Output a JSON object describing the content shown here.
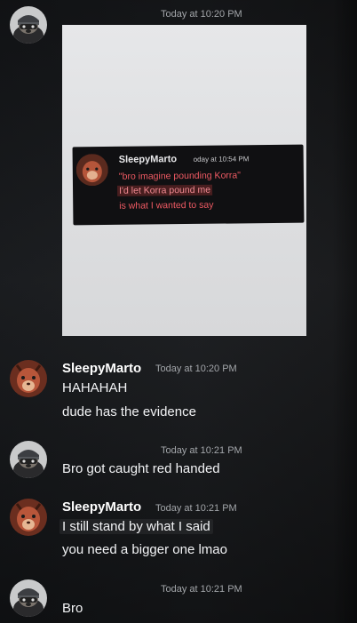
{
  "messages": [
    {
      "author": "",
      "timestamp": "Today at 10:20 PM",
      "avatar_icon": "raccoon-avatar-icon"
    },
    {
      "author": "SleepyMarto",
      "timestamp": "Today at 10:20 PM",
      "lines": [
        "HAHAHAH",
        "dude has the evidence"
      ],
      "avatar_icon": "deer-avatar-icon"
    },
    {
      "author": "",
      "timestamp": "Today at 10:21 PM",
      "lines": [
        "Bro got caught red handed"
      ],
      "avatar_icon": "raccoon-avatar-icon"
    },
    {
      "author": "SleepyMarto",
      "timestamp": "Today at 10:21 PM",
      "lines": [
        "I still stand by what I said",
        "you need a bigger one lmao"
      ],
      "avatar_icon": "deer-avatar-icon"
    },
    {
      "author": "",
      "timestamp": "Today at 10:21 PM",
      "lines": [
        "Bro"
      ],
      "avatar_icon": "raccoon-avatar-icon"
    }
  ],
  "attachment": {
    "author": "SleepyMarto",
    "timestamp": "oday at 10:54 PM",
    "quote": "\"bro imagine pounding Korra\"",
    "mention_line": "I'd let Korra pound me",
    "plain_line": "is what I wanted to say"
  },
  "colors": {
    "background": "#1b1d20",
    "username": "#ffffff",
    "timestamp": "#a3a6aa",
    "message_text": "#f2f3f5",
    "quote_red": "#ef5a63"
  }
}
